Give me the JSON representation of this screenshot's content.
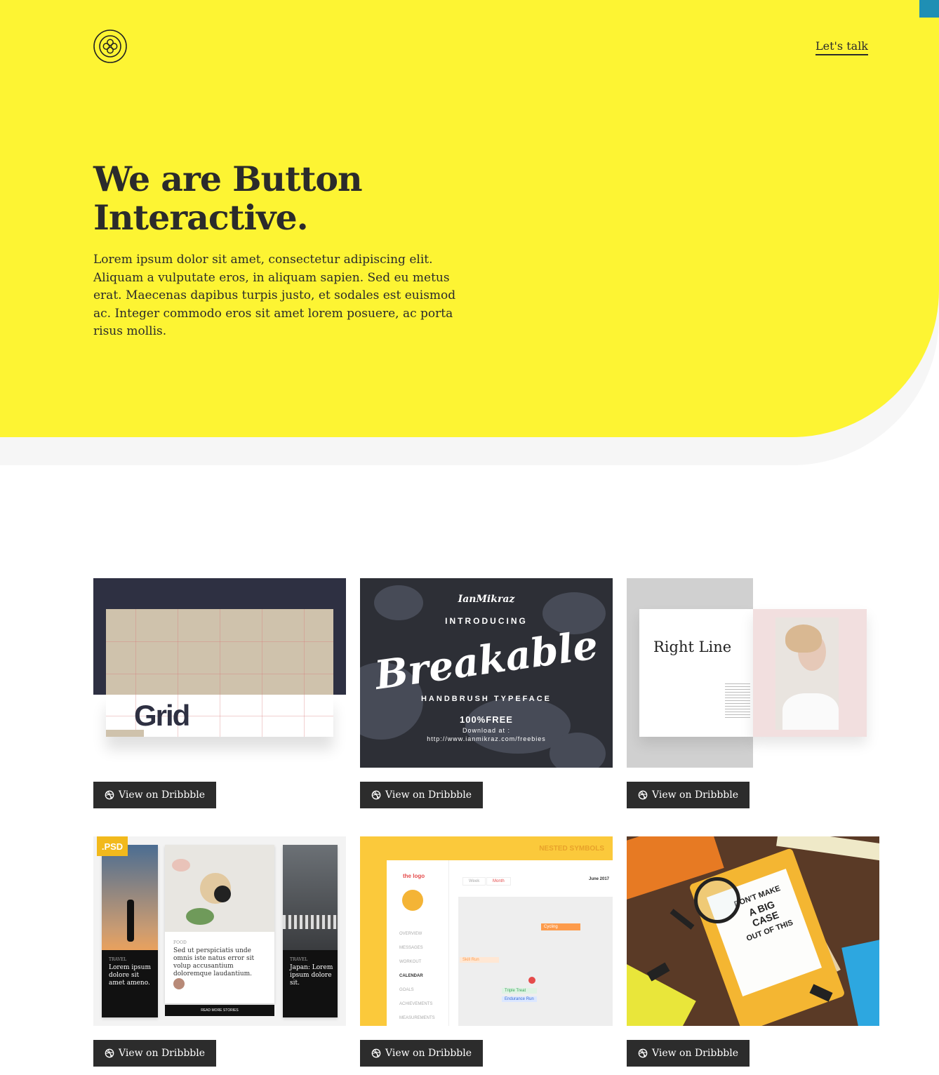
{
  "header": {
    "cta_label": "Let's talk"
  },
  "hero": {
    "headline_line1": "We are Button",
    "headline_line2": "Interactive.",
    "intro": "Lorem ipsum dolor sit amet, consectetur adipiscing elit. Aliquam a vulputate eros, in aliquam sapien. Sed eu metus erat. Maecenas dapibus turpis justo, et sodales est euismod ac. Integer commodo eros sit amet lorem posuere, ac porta risus mollis."
  },
  "colors": {
    "hero_bg": "#fdf433",
    "button_bg": "#2c2c2c",
    "accent_tab": "#1f8fb4"
  },
  "portfolio": {
    "button_label": "View on Dribbble",
    "items": [
      {
        "title": "Grid"
      },
      {
        "lines": [
          "IanMikraz",
          "INTRODUCING",
          "Breakable",
          "HANDBRUSH TYPEFACE",
          "100%FREE",
          "Download at :",
          "http://www.ianmikraz.com/freebies"
        ]
      },
      {
        "title": "Right Line"
      },
      {
        "badge": ".PSD",
        "panels": [
          {
            "tag": "TRAVEL",
            "text": "Lorem ipsum dolore sit amet ameno."
          },
          {
            "tag": "FOOD",
            "text": "Sed ut perspiciatis unde omnis iste natus error sit volup accusantium doloremque laudantium.",
            "button": "READ MORE STORIES"
          },
          {
            "tag": "TRAVEL",
            "text": "Japan: Lorem ipsum dolore sit."
          }
        ]
      },
      {
        "header": "NESTED SYMBOLS",
        "logo": "the logo",
        "tab_week": "Week",
        "tab_month": "Month",
        "month": "June 2017",
        "nav": [
          "OVERVIEW",
          "MESSAGES",
          "WORKOUT",
          "CALENDAR",
          "GOALS",
          "ACHIEVEMENTS",
          "MEASUREMENTS"
        ],
        "events": [
          "Cycling",
          "Skill Run",
          "Triple Treat",
          "Endurance Run"
        ]
      },
      {
        "note_lines": [
          "DON'T MAKE",
          "A BIG",
          "CASE",
          "OUT OF THIS"
        ]
      }
    ]
  }
}
